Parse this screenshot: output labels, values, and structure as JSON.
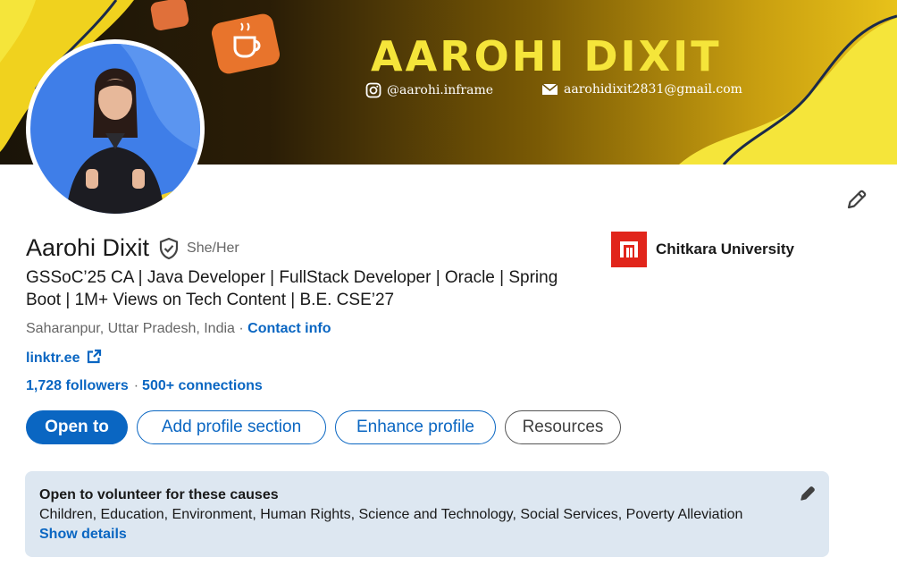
{
  "banner": {
    "title": "AAROHI DIXIT",
    "instagram": "@aarohi.inframe",
    "email": "aarohidixit2831@gmail.com"
  },
  "profile": {
    "name": "Aarohi Dixit",
    "pronouns": "She/Her",
    "headline": "GSSoC’25 CA | Java Developer | FullStack Developer | Oracle | Spring Boot | 1M+ Views on Tech Content | B.E. CSE’27",
    "location": "Saharanpur, Uttar Pradesh, India",
    "location_sep": " · ",
    "contact_info": "Contact info",
    "website": "linktr.ee",
    "followers": "1,728 followers",
    "connections": "500+ connections"
  },
  "education": {
    "name": "Chitkara University"
  },
  "actions": {
    "open_to": "Open to",
    "add_section": "Add profile section",
    "enhance": "Enhance profile",
    "resources": "Resources"
  },
  "volunteer": {
    "title": "Open to volunteer for these causes",
    "causes": "Children, Education, Environment, Human Rights, Science and Technology, Social Services, Poverty Alleviation",
    "details": "Show details"
  },
  "colors": {
    "accent": "#0a66c2",
    "banner_yellow": "#f5e53a",
    "banner_dark": "#141414",
    "university_red": "#e1251b",
    "volunteer_bg": "#dde7f1"
  },
  "icons": [
    "instagram-icon",
    "mail-icon",
    "code-icon",
    "coffee-icon",
    "verified-shield-icon",
    "pencil-icon",
    "external-link-icon",
    "university-logo"
  ]
}
